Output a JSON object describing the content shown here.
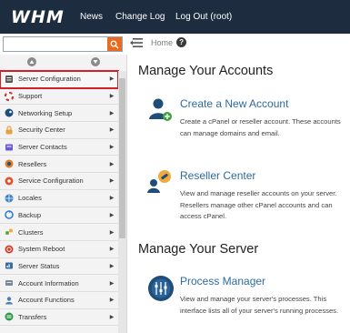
{
  "topbar": {
    "logo": "WHM",
    "nav": [
      "News",
      "Change Log",
      "Log Out (root)"
    ]
  },
  "search": {
    "value": "",
    "placeholder": ""
  },
  "breadcrumb": {
    "label": "Home",
    "help_icon": "question-circle-icon"
  },
  "sidebar": {
    "items": [
      {
        "label": "Server Configuration",
        "icon": "server-config-icon",
        "color": "#555555",
        "selected": true
      },
      {
        "label": "Support",
        "icon": "lifebuoy-icon",
        "color": "#d9342b"
      },
      {
        "label": "Networking Setup",
        "icon": "network-icon",
        "color": "#1f4d7a"
      },
      {
        "label": "Security Center",
        "icon": "lock-icon",
        "color": "#e8a13a"
      },
      {
        "label": "Server Contacts",
        "icon": "contacts-icon",
        "color": "#6a5acd"
      },
      {
        "label": "Resellers",
        "icon": "resellers-icon",
        "color": "#e07b28"
      },
      {
        "label": "Service Configuration",
        "icon": "service-config-icon",
        "color": "#e0532f"
      },
      {
        "label": "Locales",
        "icon": "locales-icon",
        "color": "#3b82c4"
      },
      {
        "label": "Backup",
        "icon": "backup-icon",
        "color": "#2f7fd1"
      },
      {
        "label": "Clusters",
        "icon": "clusters-icon",
        "color": "#55a832"
      },
      {
        "label": "System Reboot",
        "icon": "reboot-icon",
        "color": "#d23b2a"
      },
      {
        "label": "Server Status",
        "icon": "server-status-icon",
        "color": "#3c6e9c"
      },
      {
        "label": "Account Information",
        "icon": "account-info-icon",
        "color": "#7a8a99"
      },
      {
        "label": "Account Functions",
        "icon": "account-functions-icon",
        "color": "#4d7fb5"
      },
      {
        "label": "Transfers",
        "icon": "transfers-icon",
        "color": "#2e9b4c"
      }
    ]
  },
  "main": {
    "accounts_title": "Manage Your Accounts",
    "server_title": "Manage Your Server",
    "cards": [
      {
        "title": "Create a New Account",
        "desc": "Create a cPanel or reseller account. These accounts can manage domains and email.",
        "icon": "add-account-icon"
      },
      {
        "title": "Reseller Center",
        "desc": "View and manage reseller accounts on your server. Resellers manage other cPanel accounts and can access cPanel.",
        "icon": "reseller-center-icon"
      },
      {
        "title": "Process Manager",
        "desc": "View and manage your server's processes. This interface lists all of your server's running processes.",
        "icon": "process-manager-icon"
      }
    ]
  },
  "colors": {
    "topbar": "#1d2c3e",
    "accent": "#ea6a20",
    "link": "#2c6aa0",
    "selected_outline": "#d0202a"
  }
}
